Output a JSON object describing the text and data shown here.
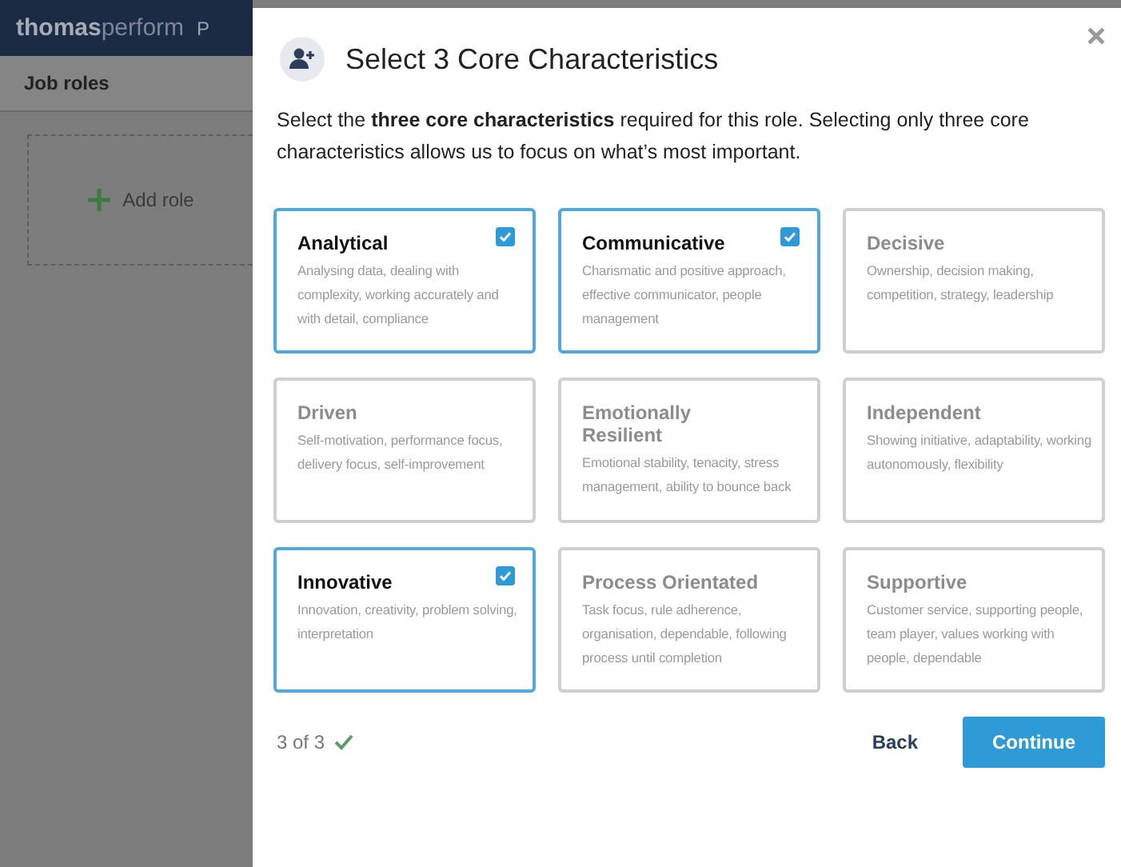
{
  "app": {
    "logo_bold": "thomas",
    "logo_light": "perform",
    "nav_cut": "P"
  },
  "sidebar": {
    "title": "Job roles",
    "add_button": "Add role"
  },
  "dialog": {
    "title": "Select 3 Core Characteristics",
    "intro": "Select the **three core characteristics** required for this role. Selecting only three core characteristics allows us to focus on what’s most important.",
    "cards": [
      {
        "title": "Analytical",
        "description": "Analysing data, dealing with complexity, working accurately and with detail, compliance",
        "selected": true
      },
      {
        "title": "Communicative",
        "description": "Charismatic and positive approach, effective communicator, people management",
        "selected": true
      },
      {
        "title": "Decisive",
        "description": "Ownership, decision making, competition, strategy, leadership",
        "selected": false
      },
      {
        "title": "Driven",
        "description": "Self-motivation, performance focus, delivery focus, self-improvement",
        "selected": false
      },
      {
        "title": "Emotionally Resilient",
        "description": "Emotional stability, tenacity, stress management, ability to bounce back",
        "selected": false
      },
      {
        "title": "Independent",
        "description": "Showing initiative, adaptability, working autonomously, flexibility",
        "selected": false
      },
      {
        "title": "Innovative",
        "description": "Innovation, creativity, problem solving, interpretation",
        "selected": true
      },
      {
        "title": "Process Orientated",
        "description": "Task focus, rule adherence, organisation, dependable, following process until completion",
        "selected": false
      },
      {
        "title": "Supportive",
        "description": "Customer service, supporting people, team player, values working with people, dependable",
        "selected": false
      }
    ],
    "count": "3 of 3",
    "back": "Back",
    "continue": "Continue"
  }
}
